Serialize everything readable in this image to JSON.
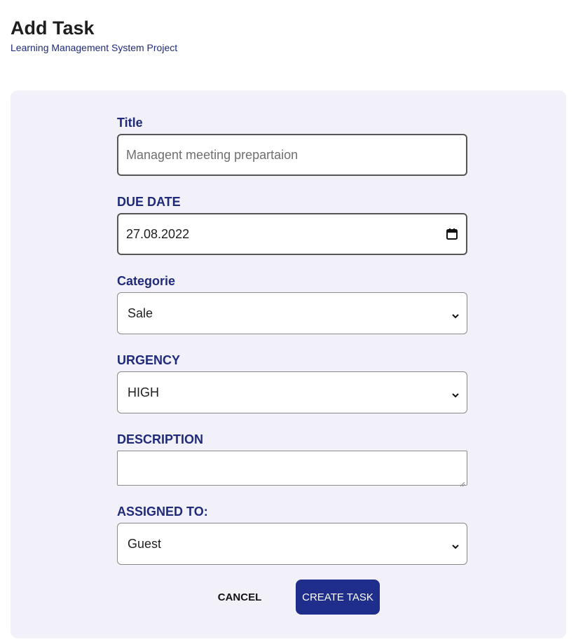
{
  "header": {
    "title": "Add Task",
    "subtitle": "Learning Management System Project"
  },
  "form": {
    "title": {
      "label": "Title",
      "placeholder": "Managent meeting prepartaion",
      "value": ""
    },
    "due_date": {
      "label": "DUE DATE",
      "value": "27.08.2022",
      "icon": "calendar-icon"
    },
    "category": {
      "label": "Categorie",
      "selected": "Sale"
    },
    "urgency": {
      "label": "URGENCY",
      "selected": "HIGH"
    },
    "description": {
      "label": "DESCRIPTION",
      "value": ""
    },
    "assigned_to": {
      "label": "ASSIGNED TO:",
      "selected": "Guest"
    }
  },
  "actions": {
    "cancel_label": "CANCEL",
    "create_label": "CREATE TASK"
  },
  "colors": {
    "accent": "#1f2e8a",
    "label": "#1f2a7a",
    "panel_bg": "#f2f1fa"
  }
}
